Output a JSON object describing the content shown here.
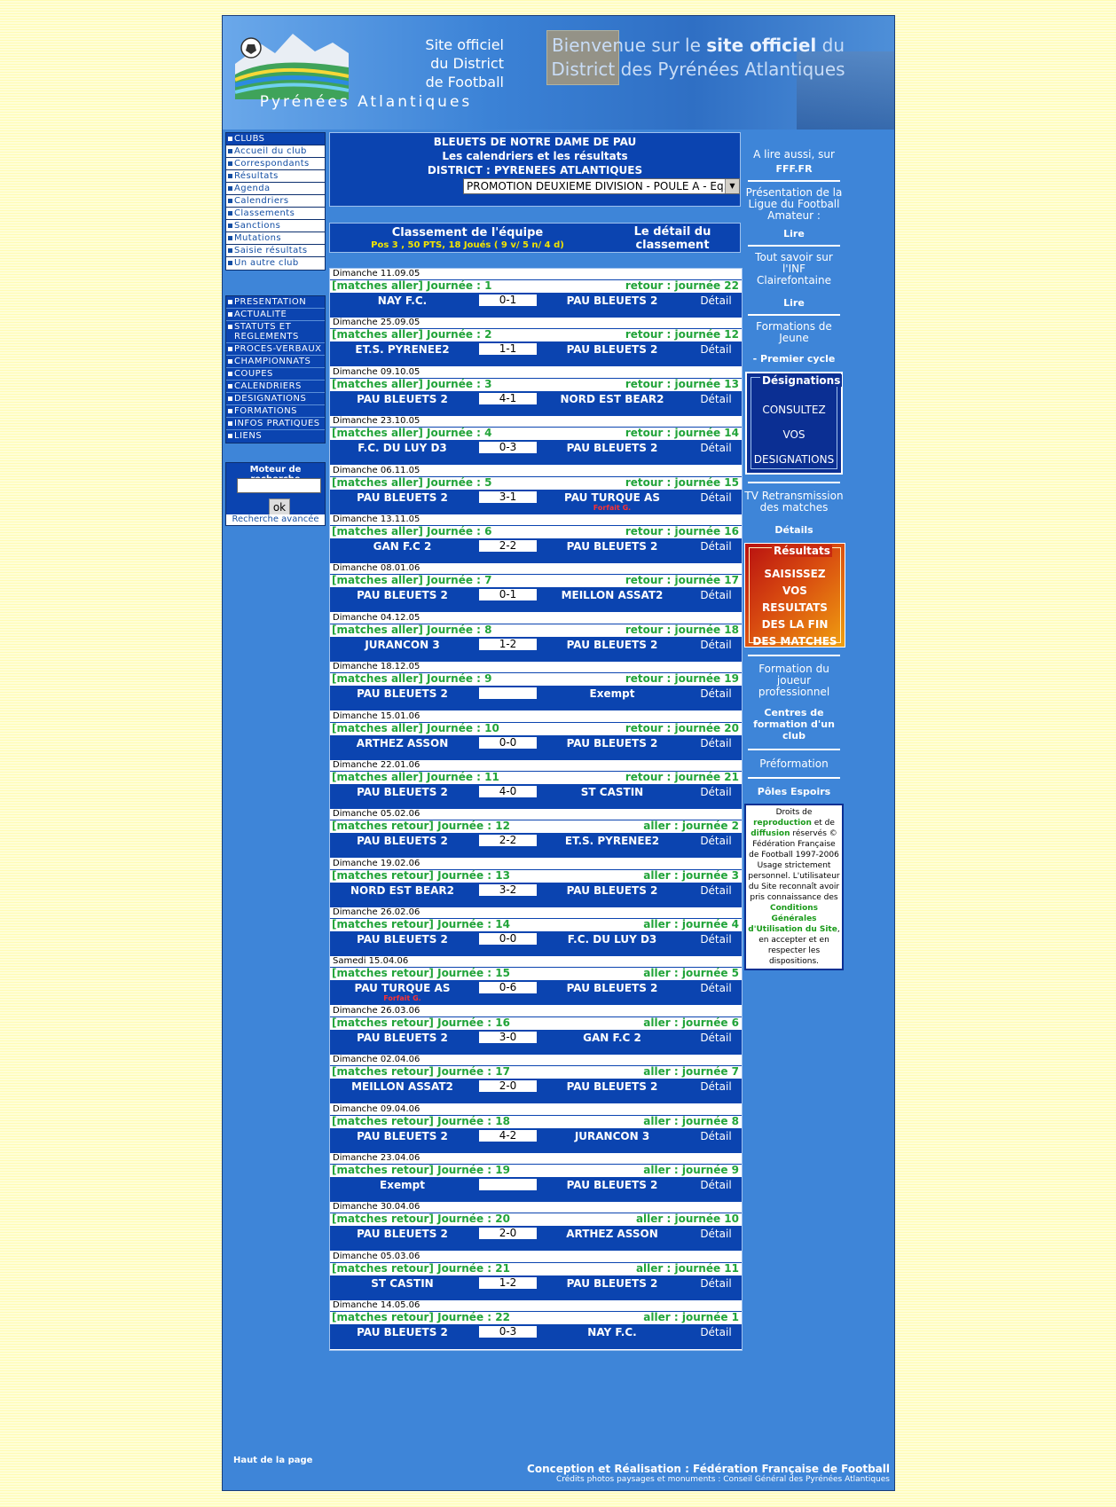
{
  "banner": {
    "site_line1": "Site officiel",
    "site_line2": "du District",
    "site_line3": "de Football",
    "region": "Pyrénées Atlantiques",
    "welcome_line1_a": "Bienvenue sur le",
    "welcome_line1_b": "site officiel",
    "welcome_line1_c": "du",
    "welcome_line2": "District des Pyrénées Atlantiques"
  },
  "nav_club": [
    "CLUBS",
    "Accueil du club",
    "Correspondants",
    "Résultats",
    "Agenda",
    "Calendriers",
    "Classements",
    "Sanctions",
    "Mutations",
    "Saisie résultats",
    "Un autre club"
  ],
  "nav_main": [
    "PRESENTATION",
    "ACTUALITE",
    "STATUTS ET REGLEMENTS",
    "PROCES-VERBAUX",
    "CHAMPIONNATS",
    "COUPES",
    "CALENDRIERS",
    "DESIGNATIONS",
    "FORMATIONS",
    "INFOS PRATIQUES",
    "LIENS"
  ],
  "search": {
    "title": "Moteur de recherche",
    "ok": "ok",
    "advanced": "Recherche avancée"
  },
  "header": {
    "club": "BLEUETS DE NOTRE DAME DE PAU",
    "subtitle": "Les calendriers et les résultats",
    "district": "DISTRICT : PYRENEES ATLANTIQUES",
    "competition": "PROMOTION DEUXIEME DIVISION - POULE A - Eq. 2"
  },
  "ranking": {
    "title": "Classement de l'équipe",
    "stats": "Pos 3 , 50 PTS, 18 Joués ( 9 v/ 5 n/ 4 d)",
    "detail": "Le détail du classement"
  },
  "detail_label": "Détail",
  "matches": [
    {
      "date": "Dimanche 11.09.05",
      "journee": "[matches aller] Journée : 1",
      "retour": "retour : journée 22",
      "home": "NAY F.C.",
      "score": "0-1",
      "away": "PAU BLEUETS 2",
      "forfait_home": "",
      "forfait_away": ""
    },
    {
      "date": "Dimanche 25.09.05",
      "journee": "[matches aller] Journée : 2",
      "retour": "retour : journée 12",
      "home": "ET.S. PYRENEE2",
      "score": "1-1",
      "away": "PAU BLEUETS 2",
      "forfait_home": "",
      "forfait_away": ""
    },
    {
      "date": "Dimanche 09.10.05",
      "journee": "[matches aller] Journée : 3",
      "retour": "retour : journée 13",
      "home": "PAU BLEUETS 2",
      "score": "4-1",
      "away": "NORD EST BEAR2",
      "forfait_home": "",
      "forfait_away": ""
    },
    {
      "date": "Dimanche 23.10.05",
      "journee": "[matches aller] Journée : 4",
      "retour": "retour : journée 14",
      "home": "F.C. DU LUY D3",
      "score": "0-3",
      "away": "PAU BLEUETS 2",
      "forfait_home": "",
      "forfait_away": ""
    },
    {
      "date": "Dimanche 06.11.05",
      "journee": "[matches aller] Journée : 5",
      "retour": "retour : journée 15",
      "home": "PAU BLEUETS 2",
      "score": "3-1",
      "away": "PAU TURQUE AS",
      "forfait_home": "",
      "forfait_away": "Forfait G."
    },
    {
      "date": "Dimanche 13.11.05",
      "journee": "[matches aller] Journée : 6",
      "retour": "retour : journée 16",
      "home": "GAN F.C 2",
      "score": "2-2",
      "away": "PAU BLEUETS 2",
      "forfait_home": "",
      "forfait_away": ""
    },
    {
      "date": "Dimanche 08.01.06",
      "journee": "[matches aller] Journée : 7",
      "retour": "retour : journée 17",
      "home": "PAU BLEUETS 2",
      "score": "0-1",
      "away": "MEILLON ASSAT2",
      "forfait_home": "",
      "forfait_away": ""
    },
    {
      "date": "Dimanche 04.12.05",
      "journee": "[matches aller] Journée : 8",
      "retour": "retour : journée 18",
      "home": "JURANCON 3",
      "score": "1-2",
      "away": "PAU BLEUETS 2",
      "forfait_home": "",
      "forfait_away": ""
    },
    {
      "date": "Dimanche 18.12.05",
      "journee": "[matches aller] Journée : 9",
      "retour": "retour : journée 19",
      "home": "PAU BLEUETS 2",
      "score": "",
      "away": "Exempt",
      "forfait_home": "",
      "forfait_away": ""
    },
    {
      "date": "Dimanche 15.01.06",
      "journee": "[matches aller] Journée : 10",
      "retour": "retour : journée 20",
      "home": "ARTHEZ ASSON",
      "score": "0-0",
      "away": "PAU BLEUETS 2",
      "forfait_home": "",
      "forfait_away": ""
    },
    {
      "date": "Dimanche 22.01.06",
      "journee": "[matches aller] Journée : 11",
      "retour": "retour : journée 21",
      "home": "PAU BLEUETS 2",
      "score": "4-0",
      "away": "ST CASTIN",
      "forfait_home": "",
      "forfait_away": ""
    },
    {
      "date": "Dimanche 05.02.06",
      "journee": "[matches retour] Journée : 12",
      "retour": "aller : journée 2",
      "home": "PAU BLEUETS 2",
      "score": "2-2",
      "away": "ET.S. PYRENEE2",
      "forfait_home": "",
      "forfait_away": ""
    },
    {
      "date": "Dimanche 19.02.06",
      "journee": "[matches retour] Journée : 13",
      "retour": "aller : journée 3",
      "home": "NORD EST BEAR2",
      "score": "3-2",
      "away": "PAU BLEUETS 2",
      "forfait_home": "",
      "forfait_away": ""
    },
    {
      "date": "Dimanche 26.02.06",
      "journee": "[matches retour] Journée : 14",
      "retour": "aller : journée 4",
      "home": "PAU BLEUETS 2",
      "score": "0-0",
      "away": "F.C. DU LUY D3",
      "forfait_home": "",
      "forfait_away": ""
    },
    {
      "date": "Samedi 15.04.06",
      "journee": "[matches retour] Journée : 15",
      "retour": "aller : journée 5",
      "home": "PAU TURQUE AS",
      "score": "0-6",
      "away": "PAU BLEUETS 2",
      "forfait_home": "Forfait G.",
      "forfait_away": ""
    },
    {
      "date": "Dimanche 26.03.06",
      "journee": "[matches retour] Journée : 16",
      "retour": "aller : journée 6",
      "home": "PAU BLEUETS 2",
      "score": "3-0",
      "away": "GAN F.C 2",
      "forfait_home": "",
      "forfait_away": ""
    },
    {
      "date": "Dimanche 02.04.06",
      "journee": "[matches retour] Journée : 17",
      "retour": "aller : journée 7",
      "home": "MEILLON ASSAT2",
      "score": "2-0",
      "away": "PAU BLEUETS 2",
      "forfait_home": "",
      "forfait_away": ""
    },
    {
      "date": "Dimanche 09.04.06",
      "journee": "[matches retour] Journée : 18",
      "retour": "aller : journée 8",
      "home": "PAU BLEUETS 2",
      "score": "4-2",
      "away": "JURANCON 3",
      "forfait_home": "",
      "forfait_away": ""
    },
    {
      "date": "Dimanche 23.04.06",
      "journee": "[matches retour] Journée : 19",
      "retour": "aller : journée 9",
      "home": "Exempt",
      "score": "",
      "away": "PAU BLEUETS 2",
      "forfait_home": "",
      "forfait_away": ""
    },
    {
      "date": "Dimanche 30.04.06",
      "journee": "[matches retour] Journée : 20",
      "retour": "aller : journée 10",
      "home": "PAU BLEUETS 2",
      "score": "2-0",
      "away": "ARTHEZ ASSON",
      "forfait_home": "",
      "forfait_away": ""
    },
    {
      "date": "Dimanche 05.03.06",
      "journee": "[matches retour] Journée : 21",
      "retour": "aller : journée 11",
      "home": "ST CASTIN",
      "score": "1-2",
      "away": "PAU BLEUETS 2",
      "forfait_home": "",
      "forfait_away": ""
    },
    {
      "date": "Dimanche 14.05.06",
      "journee": "[matches retour] Journée : 22",
      "retour": "aller : journée 1",
      "home": "PAU BLEUETS 2",
      "score": "0-3",
      "away": "NAY F.C.",
      "forfait_home": "",
      "forfait_away": ""
    }
  ],
  "right": {
    "alire": "A lire aussi, sur",
    "fff": "FFF.FR",
    "presentation": "Présentation de la Ligue du Football Amateur :",
    "lire1": "Lire",
    "toutsavoir": "Tout savoir sur l'INF Clairefontaine",
    "lire2": "Lire",
    "formations": "Formations de Jeune",
    "premier": "- Premier cycle",
    "designations_legend": "Désignations",
    "designations_l1": "CONSULTEZ",
    "designations_l2": "VOS",
    "designations_l3": "DESIGNATIONS",
    "tv": "TV Retransmission des matches",
    "details": "Détails",
    "resultats_legend": "Résultats",
    "resultats_l1": "SAISISSEZ",
    "resultats_l2": "VOS RESULTATS",
    "resultats_l3": "DES LA FIN",
    "resultats_l4": "DES MATCHES",
    "formation_joueur": "Formation du joueur professionnel",
    "centres": "Centres de formation d'un club",
    "preformation": "Préformation",
    "poles": "Pôles Espoirs",
    "copy1": "Droits de",
    "copy_repro": "reproduction",
    "copy2": "et de",
    "copy_diff": "diffusion",
    "copy3": "réservés © Fédération Française de Football 1997-2006 Usage strictement personnel. L'utilisateur du Site reconnaît avoir pris connaissance des",
    "copy_cond": "Conditions Générales d'Utilisation du Site",
    "copy4": ", en accepter et en respecter les dispositions."
  },
  "footer": {
    "top": "Haut de la page",
    "conception": "Conception et Réalisation : Fédération Française de Football",
    "credits": "Crédits photos paysages et monuments : Conseil Général des Pyrénées Atlantiques"
  },
  "colors": {
    "page_bg": "#fffec8",
    "frame": "#3e85d8",
    "navy": "#0b44b0",
    "green": "#22a43a",
    "forfait": "#ff3030",
    "stats": "#f2e400"
  }
}
